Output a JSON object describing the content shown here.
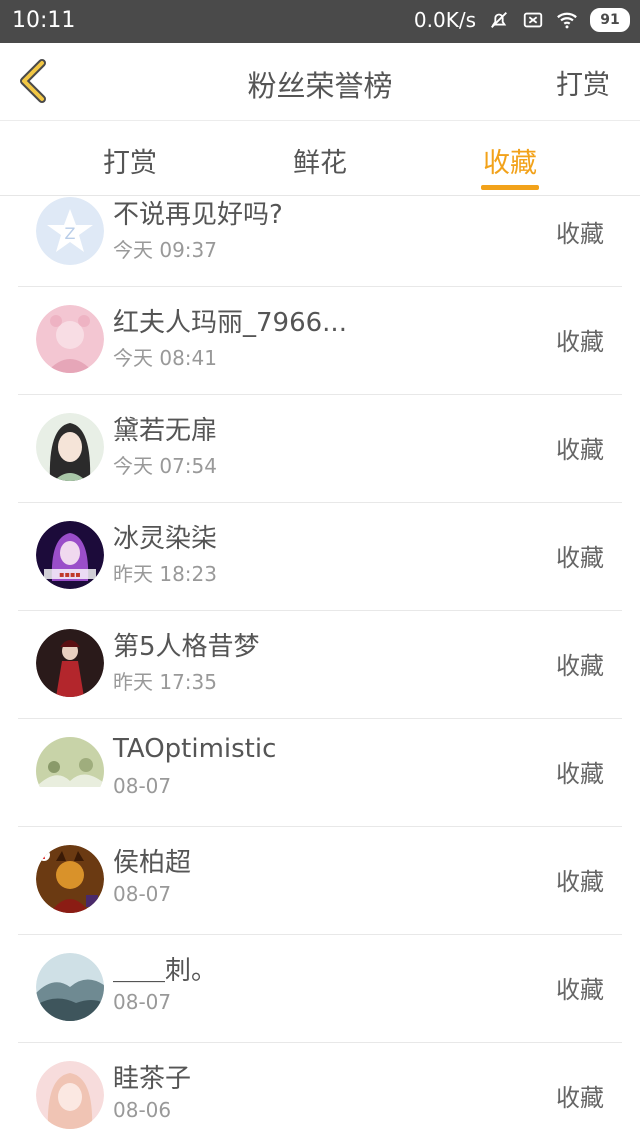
{
  "status_bar": {
    "time": "10:11",
    "net_speed": "0.0K/s",
    "battery": "91",
    "icons": [
      "mute-bell-icon",
      "sim-off-icon",
      "wifi-icon",
      "battery-icon"
    ]
  },
  "nav": {
    "title": "粉丝荣誉榜",
    "right_label": "打赏",
    "back_icon": "chevron-left-icon"
  },
  "tabs": [
    {
      "label": "打赏",
      "active": false
    },
    {
      "label": "鲜花",
      "active": false
    },
    {
      "label": "收藏",
      "active": true
    }
  ],
  "colors": {
    "accent": "#f2a21a",
    "status_bar": "#4a4a4a"
  },
  "items": [
    {
      "name": "不说再见好吗?",
      "time": "今天 09:37",
      "action": "收藏"
    },
    {
      "name": "红夫人玛丽_7966...",
      "time": "今天 08:41",
      "action": "收藏"
    },
    {
      "name": "黛若无扉",
      "time": "今天 07:54",
      "action": "收藏"
    },
    {
      "name": "冰灵染柒",
      "time": "昨天 18:23",
      "action": "收藏"
    },
    {
      "name": "第5人格昔梦",
      "time": "昨天 17:35",
      "action": "收藏"
    },
    {
      "name": "TAOptimistic",
      "time": "08-07",
      "action": "收藏"
    },
    {
      "name": "侯柏超",
      "time": "08-07",
      "action": "收藏"
    },
    {
      "name": "＿＿刺。",
      "time": "08-07",
      "action": "收藏"
    },
    {
      "name": "眭茶子",
      "time": "08-06",
      "action": "收藏"
    }
  ]
}
